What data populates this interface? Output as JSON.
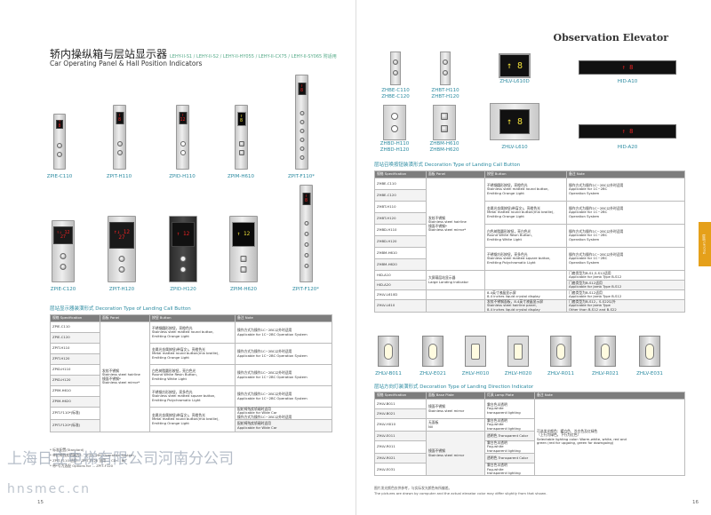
{
  "left": {
    "title_cn": "轿内操纵箱与层站显示器",
    "title_models": "LEHY-II-S1 / LEHY-II-S2 / LEHY-II-HY055 / LEHY-II-CX75 / LEHY-II-SY065 附适用",
    "title_en": "Car Operating Panel & Hall Position Indicators",
    "panels_row1": [
      {
        "label": "ZPIE-C110",
        "display": "↑ 8"
      },
      {
        "label": "ZPIT-H110",
        "display": "↑ 8"
      },
      {
        "label": "ZPID-H110",
        "display": "↑ 12"
      },
      {
        "label": "ZPIM-H610",
        "display": "↑ 8"
      },
      {
        "label": "ZPIT-F110*",
        "display": "↑ 8"
      }
    ],
    "panels_row2": [
      {
        "label": "ZPIE-C120",
        "display": "↑↓ 12 27"
      },
      {
        "label": "ZPIT-H120",
        "display": "↑↓ 12 27"
      },
      {
        "label": "ZPID-H120",
        "display": "↑ 12"
      },
      {
        "label": "ZPIM-H620",
        "display": "↑ 12"
      },
      {
        "label": "ZPIT-F120*",
        "display": "↑ 8"
      }
    ],
    "section_title": "层站显示器装潢形式 Decoration Type of Landing Call Button",
    "table_headers": [
      "规格 Specification",
      "面板 Panel",
      "按钮 Button",
      "备注 Note"
    ],
    "table_rows": [
      {
        "spec": "ZPIE-C110",
        "button": "不锈钢圆形按钮，亮橙色光\nStainless steel matted round button,\nEmitting Orange Light",
        "note": "操作方式为操作1C~2BC以外时适用\nApplicable for 1C~2BC Operation System"
      },
      {
        "spec": "ZPIE-C120",
        "button": "",
        "note": ""
      },
      {
        "spec": "ZPIT-H110",
        "button": "金属光金属按钮(带盲文)，亮橙色光\nMetal matted round button(mix braille),\nEmitting Orange Light",
        "note": "操作方式为操作1C~2BC以外时适用\nApplicable for 1C~2BC Operation System"
      },
      {
        "spec": "ZPIT-H120",
        "button": "",
        "note": ""
      },
      {
        "spec": "ZPID-H110",
        "button": "白色树脂圆形按钮，亮白色光\nRound White Resin Button,\nEmitting White Light",
        "note": "操作方式为操作1C~2BC以外时适用\nApplicable for 1C~2BC Operation System"
      },
      {
        "spec": "ZPID-H120",
        "button": "",
        "note": ""
      },
      {
        "spec": "ZPIM-H610",
        "button": "不锈钢方形按钮，亮多色光\nStainless steel matted square button,\nEmitting Polychromatic Light",
        "note": "操作方式为操作1C~2BC以外时适用\nApplicable for 1C~2BC Operation System"
      },
      {
        "spec": "ZPIM-H620",
        "button": "",
        "note": ""
      },
      {
        "spec": "ZPIT-F110*(标准)",
        "button": "金属光金属按钮(带盲文)，亮橙色光\nMetal matted round button(mix braille),\nEmitting Orange Light",
        "note": "配轮椅残疾轿厢时适用\nApplicable for Wide Car\n操作方式为操作1C~2BC以外时适用"
      },
      {
        "spec": "ZPIT-F120*(标准)",
        "button": "",
        "note": "配轮椅残疾轿厢时适用\nApplicable for Wide Car"
      }
    ],
    "panel_col": "发纹不锈钢\nStainless steel hairline\n镜面不锈钢*\nStainless steel mirror*",
    "footnotes": [
      "* 标准配置(Standard)",
      "* 单轮椅残疾轿厢为F... 1CD / 2BC Operation System",
      "* ZPIT-F110 适用... ZPIT-F120 适用 ... CD ... BC",
      "* 带*号为选配 Options for ... ZPIT-F120"
    ],
    "page_number": "15",
    "watermark_cn": "上海日立电梯有限公司河南分公司",
    "watermark_url": "hnsmec.cn"
  },
  "right": {
    "header": "Observation Elevator",
    "hall_top": [
      {
        "label": "ZHBE-C110\nZHBE-C120"
      },
      {
        "label": "ZHBT-H110\nZHBT-H120"
      },
      {
        "label": "ZHLV-L610D",
        "display": "↑ 8"
      },
      {
        "label": "HID-A10",
        "display": "↑ 8"
      }
    ],
    "hall_bottom": [
      {
        "label": "ZHBD-H110\nZHBD-H120"
      },
      {
        "label": "ZHBM-H610\nZHBM-H620"
      },
      {
        "label": "ZHLV-L610",
        "display": "↑ 8"
      },
      {
        "label": "HID-A20",
        "display": "↑ 8"
      }
    ],
    "section1_title": "层站召唤按钮装潢形式 Decoration Type of Landing Call Button",
    "table1_headers": [
      "规格 Specification",
      "面板 Panel",
      "按钮 Button",
      "备注 Note"
    ],
    "table1_rows": [
      {
        "spec": "ZHBE-C110",
        "button": "不锈钢圆形按钮，亮橙色光\nStainless steel matted round button,\nEmitting Orange Light",
        "note": "操作方式为操作1C~2BC以外时适用\nApplicable for 1C~2BC\nOperation System"
      },
      {
        "spec": "ZHBE-C120",
        "button": "",
        "note": ""
      },
      {
        "spec": "ZHBT-H110",
        "button": "金属光金属按钮(带盲文)，亮橙色光\nMetal matted round button(mix braille),\nEmitting Orange Light",
        "note": "操作方式为操作1C~2BC以外时适用\nApplicable for 1C~2BC\nOperation System"
      },
      {
        "spec": "ZHBT-H120",
        "button": "",
        "note": ""
      },
      {
        "spec": "ZHBD-H110",
        "button": "白色树脂圆形按钮，亮白色光\nRound White Resin Button,\nEmitting White Light",
        "note": "操作方式为操作1C~2BC以外时适用\nApplicable for 1C~2BC\nOperation System"
      },
      {
        "spec": "ZHBD-H120",
        "button": "",
        "note": ""
      },
      {
        "spec": "ZHBM-H610",
        "button": "不锈钢方形按钮，亮多色光\nStainless steel matted square button,\nEmitting Polychromatic Light",
        "note": "操作方式为操作1C~2BC以外时适用\nApplicable for 1C~2BC\nOperation System"
      },
      {
        "spec": "ZHBM-H620",
        "button": "",
        "note": ""
      },
      {
        "spec": "HID-A10",
        "button": "大屏幕层站显示器\nLarge Landing Indicator",
        "note": "门套类型为B-S1,S-S12适用\nApplicable for Jamb Type B-S12"
      },
      {
        "spec": "HID-A20",
        "button": "",
        "note": "门套类型为B-S12适用\nApplicable for Jamb Type B-S12"
      },
      {
        "spec": "ZHLV-L610D",
        "button": "8.4英寸液晶显示屏\n8.4 inches liquid crystal display",
        "note": "门套类型为B-S12适用\nApplicable for Jamb Type B-S12"
      },
      {
        "spec": "ZHLV-L610",
        "button": "发纹不锈钢面板，8.4英寸液晶显示屏\nStainless steel hairline panel,\n8.4 inches liquid crystal display",
        "note": "门套类型为B-S12，S-S22以外\nApplicable for Jamb Type\nOther than B-S12 and B-S22"
      }
    ],
    "panel_col1": "发纹不锈钢\nStainless steel hairline\n镜面不锈钢*\nStainless steel mirror*",
    "dir_labels": [
      "ZHLV-B011",
      "ZHLV-E021",
      "ZHLV-H010",
      "ZHLV-H020",
      "ZHLV-R011",
      "ZHLV-R021",
      "ZHLV-E031"
    ],
    "section2_title": "层站方向灯装潢形式 Decoration Type of Landing Direction Indicator",
    "table2_headers": [
      "规格 Specification",
      "面板 Base Plate",
      "灯具 Lamp Plate",
      "备注 Note"
    ],
    "table2_rows": [
      {
        "spec": "ZHLV-B011",
        "panel": "镜面不锈钢\nStainless steel mirror",
        "lamp": "雾白色半透明\nFog-white\ntransparent lighting"
      },
      {
        "spec": "ZHLV-B021",
        "panel": "",
        "lamp": ""
      },
      {
        "spec": "ZHLV-H010",
        "panel": "无面板\nNil",
        "lamp": "雾白色半透明\nFog-white\ntransparent lighting"
      },
      {
        "spec": "ZHLV-E011",
        "panel": "",
        "lamp": "透明色 Transparent Color"
      },
      {
        "spec": "ZHLV-R011",
        "panel": "镜面不锈钢\nStainless steel mirror",
        "lamp": "雾白色半透明\nFog-white\ntransparent lighting"
      },
      {
        "spec": "ZHLV-R021",
        "panel": "",
        "lamp": "透明色 Transparent Color"
      },
      {
        "spec": "ZHLV-E031",
        "panel": "",
        "lamp": "雾白色半透明\nFog-white\ntransparent lighting"
      }
    ],
    "table2_note": "可选发光颜色：暖白色、冷白色及红绿色\n（上行为绿色，下行为红色）\nSelectable lighting color: Warm-white, white, red and\ngreen (red for upgoing, green for downgoing)",
    "bottom_note_cn": "图片发光颜色仅供参考，与实际发光颜色有所偏差。",
    "bottom_note_en": "The pictures are drawn by computer and the actual elevator color may differ slightly from that shown.",
    "side_tab": "层站 Landing",
    "page_number": "16"
  },
  "colors": {
    "accent": "#2a8aa0",
    "orange_tab": "#e5a01a",
    "display_red": "#e22",
    "lcd_yellow": "#f3e23a"
  }
}
